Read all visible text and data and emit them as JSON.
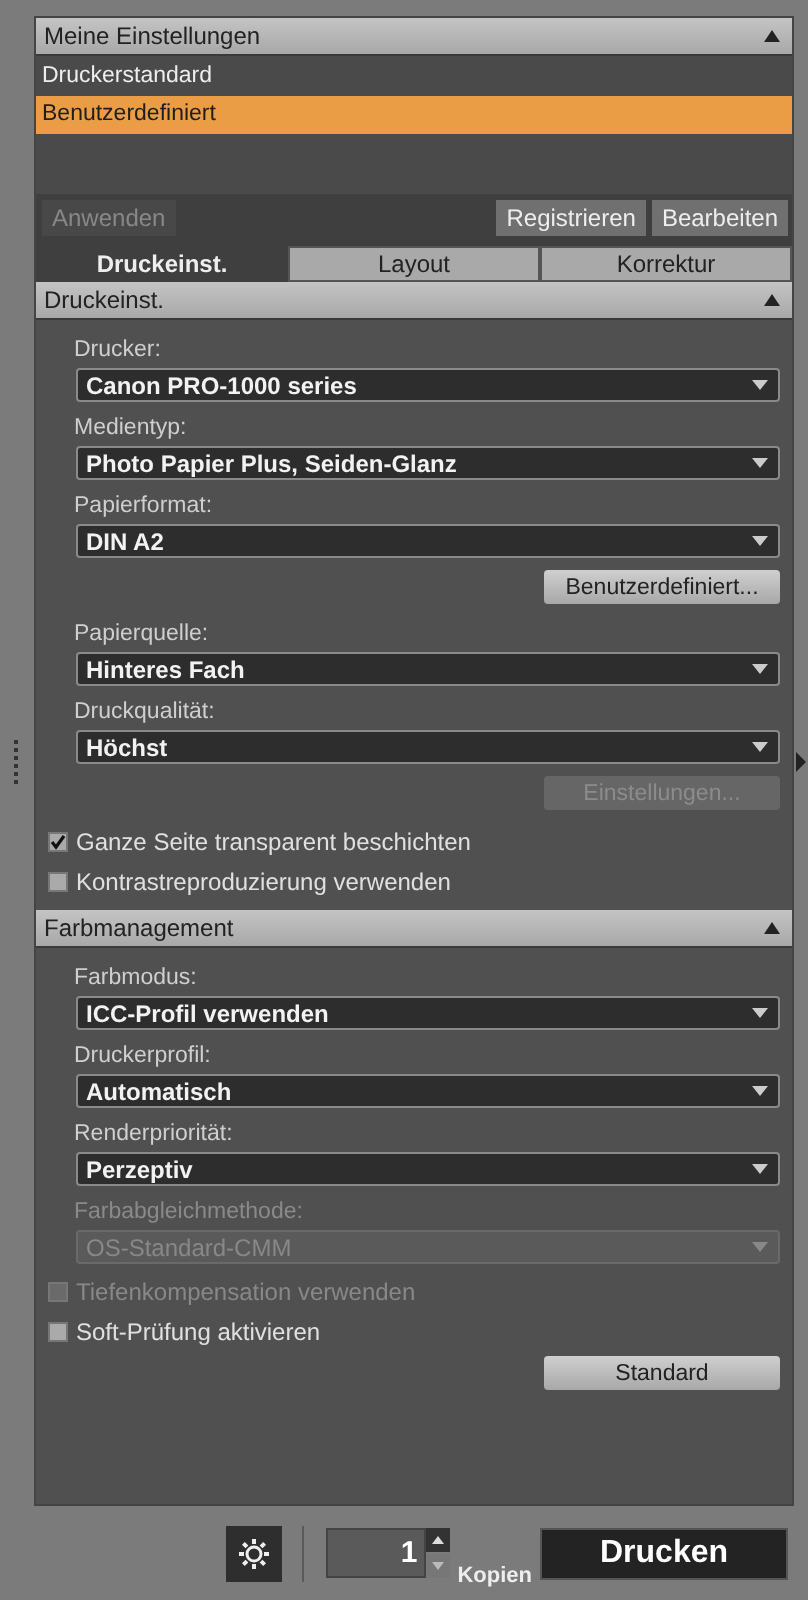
{
  "presets": {
    "title": "Meine Einstellungen",
    "expanded": true,
    "items": [
      {
        "label": "Druckerstandard",
        "selected": false
      },
      {
        "label": "Benutzerdefiniert",
        "selected": true
      }
    ]
  },
  "preset_buttons": [
    {
      "label": "Anwenden",
      "disabled": true
    },
    {
      "label": "Registrieren",
      "disabled": false
    },
    {
      "label": "Bearbeiten",
      "disabled": false
    }
  ],
  "tabs": [
    {
      "label": "Druckeinst.",
      "selected": true
    },
    {
      "label": "Layout",
      "selected": false
    },
    {
      "label": "Korrektur",
      "selected": false
    }
  ],
  "sections": [
    {
      "title": "Druckeinst.",
      "expanded": true,
      "controls": [
        {
          "kind": "select",
          "label": "Drucker:",
          "value": "Canon PRO-1000 series",
          "disabled": false
        },
        {
          "kind": "select",
          "label": "Medientyp:",
          "value": "Photo Papier Plus, Seiden-Glanz",
          "disabled": false
        },
        {
          "kind": "select",
          "label": "Papierformat:",
          "value": "DIN A2",
          "disabled": false
        },
        {
          "kind": "button",
          "label": "Benutzerdefiniert...",
          "disabled": false
        },
        {
          "kind": "select",
          "label": "Papierquelle:",
          "value": "Hinteres Fach",
          "disabled": false
        },
        {
          "kind": "select",
          "label": "Druckqualität:",
          "value": "Höchst",
          "disabled": false
        },
        {
          "kind": "button",
          "label": "Einstellungen...",
          "disabled": true
        },
        {
          "kind": "checkbox",
          "label": "Ganze Seite transparent beschichten",
          "checked": true,
          "disabled": false
        },
        {
          "kind": "checkbox",
          "label": "Kontrastreproduzierung verwenden",
          "checked": false,
          "disabled": false
        }
      ]
    },
    {
      "title": "Farbmanagement",
      "expanded": true,
      "controls": [
        {
          "kind": "select",
          "label": "Farbmodus:",
          "value": "ICC-Profil verwenden",
          "disabled": false
        },
        {
          "kind": "select",
          "label": "Druckerprofil:",
          "value": "Automatisch",
          "disabled": false
        },
        {
          "kind": "select",
          "label": "Renderpriorität:",
          "value": "Perzeptiv",
          "disabled": false
        },
        {
          "kind": "select",
          "label": "Farbabgleichmethode:",
          "value": "OS-Standard-CMM",
          "disabled": true
        },
        {
          "kind": "checkbox",
          "label": "Tiefenkompensation verwenden",
          "checked": false,
          "disabled": true
        },
        {
          "kind": "checkbox",
          "label": "Soft-Prüfung aktivieren",
          "checked": false,
          "disabled": false
        },
        {
          "kind": "button",
          "label": "Standard",
          "disabled": false
        }
      ]
    }
  ],
  "footer": {
    "copies": "1",
    "copies_label": "Kopien",
    "print_button": "Drucken"
  }
}
